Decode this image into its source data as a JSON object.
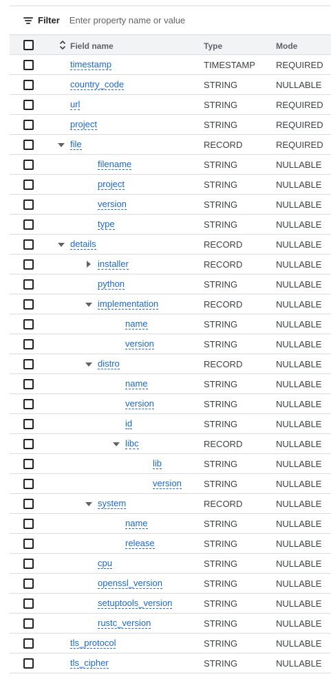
{
  "filter": {
    "label": "Filter",
    "placeholder": "Enter property name or value"
  },
  "header": {
    "field_name": "Field name",
    "type": "Type",
    "mode": "Mode"
  },
  "rows": [
    {
      "name": "timestamp",
      "type": "TIMESTAMP",
      "mode": "REQUIRED",
      "depth": 0,
      "expander": "none"
    },
    {
      "name": "country_code",
      "type": "STRING",
      "mode": "NULLABLE",
      "depth": 0,
      "expander": "none"
    },
    {
      "name": "url",
      "type": "STRING",
      "mode": "REQUIRED",
      "depth": 0,
      "expander": "none"
    },
    {
      "name": "project",
      "type": "STRING",
      "mode": "REQUIRED",
      "depth": 0,
      "expander": "none"
    },
    {
      "name": "file",
      "type": "RECORD",
      "mode": "REQUIRED",
      "depth": 0,
      "expander": "expanded"
    },
    {
      "name": "filename",
      "type": "STRING",
      "mode": "NULLABLE",
      "depth": 1,
      "expander": "none"
    },
    {
      "name": "project",
      "type": "STRING",
      "mode": "NULLABLE",
      "depth": 1,
      "expander": "none"
    },
    {
      "name": "version",
      "type": "STRING",
      "mode": "NULLABLE",
      "depth": 1,
      "expander": "none"
    },
    {
      "name": "type",
      "type": "STRING",
      "mode": "NULLABLE",
      "depth": 1,
      "expander": "none"
    },
    {
      "name": "details",
      "type": "RECORD",
      "mode": "NULLABLE",
      "depth": 0,
      "expander": "expanded"
    },
    {
      "name": "installer",
      "type": "RECORD",
      "mode": "NULLABLE",
      "depth": 1,
      "expander": "collapsed"
    },
    {
      "name": "python",
      "type": "STRING",
      "mode": "NULLABLE",
      "depth": 1,
      "expander": "none"
    },
    {
      "name": "implementation",
      "type": "RECORD",
      "mode": "NULLABLE",
      "depth": 1,
      "expander": "expanded"
    },
    {
      "name": "name",
      "type": "STRING",
      "mode": "NULLABLE",
      "depth": 2,
      "expander": "none"
    },
    {
      "name": "version",
      "type": "STRING",
      "mode": "NULLABLE",
      "depth": 2,
      "expander": "none"
    },
    {
      "name": "distro",
      "type": "RECORD",
      "mode": "NULLABLE",
      "depth": 1,
      "expander": "expanded"
    },
    {
      "name": "name",
      "type": "STRING",
      "mode": "NULLABLE",
      "depth": 2,
      "expander": "none"
    },
    {
      "name": "version",
      "type": "STRING",
      "mode": "NULLABLE",
      "depth": 2,
      "expander": "none"
    },
    {
      "name": "id",
      "type": "STRING",
      "mode": "NULLABLE",
      "depth": 2,
      "expander": "none"
    },
    {
      "name": "libc",
      "type": "RECORD",
      "mode": "NULLABLE",
      "depth": 2,
      "expander": "expanded"
    },
    {
      "name": "lib",
      "type": "STRING",
      "mode": "NULLABLE",
      "depth": 3,
      "expander": "none"
    },
    {
      "name": "version",
      "type": "STRING",
      "mode": "NULLABLE",
      "depth": 3,
      "expander": "none"
    },
    {
      "name": "system",
      "type": "RECORD",
      "mode": "NULLABLE",
      "depth": 1,
      "expander": "expanded"
    },
    {
      "name": "name",
      "type": "STRING",
      "mode": "NULLABLE",
      "depth": 2,
      "expander": "none"
    },
    {
      "name": "release",
      "type": "STRING",
      "mode": "NULLABLE",
      "depth": 2,
      "expander": "none"
    },
    {
      "name": "cpu",
      "type": "STRING",
      "mode": "NULLABLE",
      "depth": 1,
      "expander": "none"
    },
    {
      "name": "openssl_version",
      "type": "STRING",
      "mode": "NULLABLE",
      "depth": 1,
      "expander": "none"
    },
    {
      "name": "setuptools_version",
      "type": "STRING",
      "mode": "NULLABLE",
      "depth": 1,
      "expander": "none"
    },
    {
      "name": "rustc_version",
      "type": "STRING",
      "mode": "NULLABLE",
      "depth": 1,
      "expander": "none"
    },
    {
      "name": "tls_protocol",
      "type": "STRING",
      "mode": "NULLABLE",
      "depth": 0,
      "expander": "none"
    },
    {
      "name": "tls_cipher",
      "type": "STRING",
      "mode": "NULLABLE",
      "depth": 0,
      "expander": "none"
    }
  ]
}
